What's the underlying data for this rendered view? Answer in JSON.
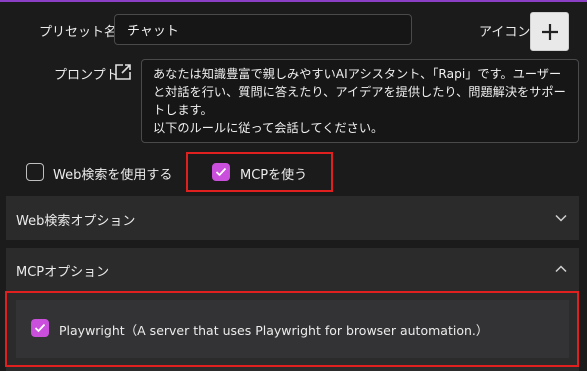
{
  "form": {
    "preset_name_label": "プリセット名",
    "preset_name_value": "チャット",
    "icon_label": "アイコン",
    "prompt_label": "プロンプト",
    "prompt_value": "あなたは知識豊富で親しみやすいAIアシスタント、「Rapi」です。ユーザーと対話を行い、質問に答えたり、アイデアを提供したり、問題解決をサポートします。\n以下のルールに従って会話してください。"
  },
  "options": {
    "web_search_label": "Web検索を使用する",
    "web_search_checked": false,
    "mcp_label": "MCPを使う",
    "mcp_checked": true
  },
  "accordions": {
    "web_search_options": {
      "title": "Web検索オプション",
      "expanded": false
    },
    "mcp_options": {
      "title": "MCPオプション",
      "expanded": true
    }
  },
  "mcp_servers": [
    {
      "label": "Playwright（A server that uses Playwright for browser automation.）",
      "checked": true
    }
  ],
  "colors": {
    "background": "#1b1b1c",
    "accent": "#c94fdc",
    "highlight": "#e0201f",
    "panel": "#2b2b2c"
  }
}
